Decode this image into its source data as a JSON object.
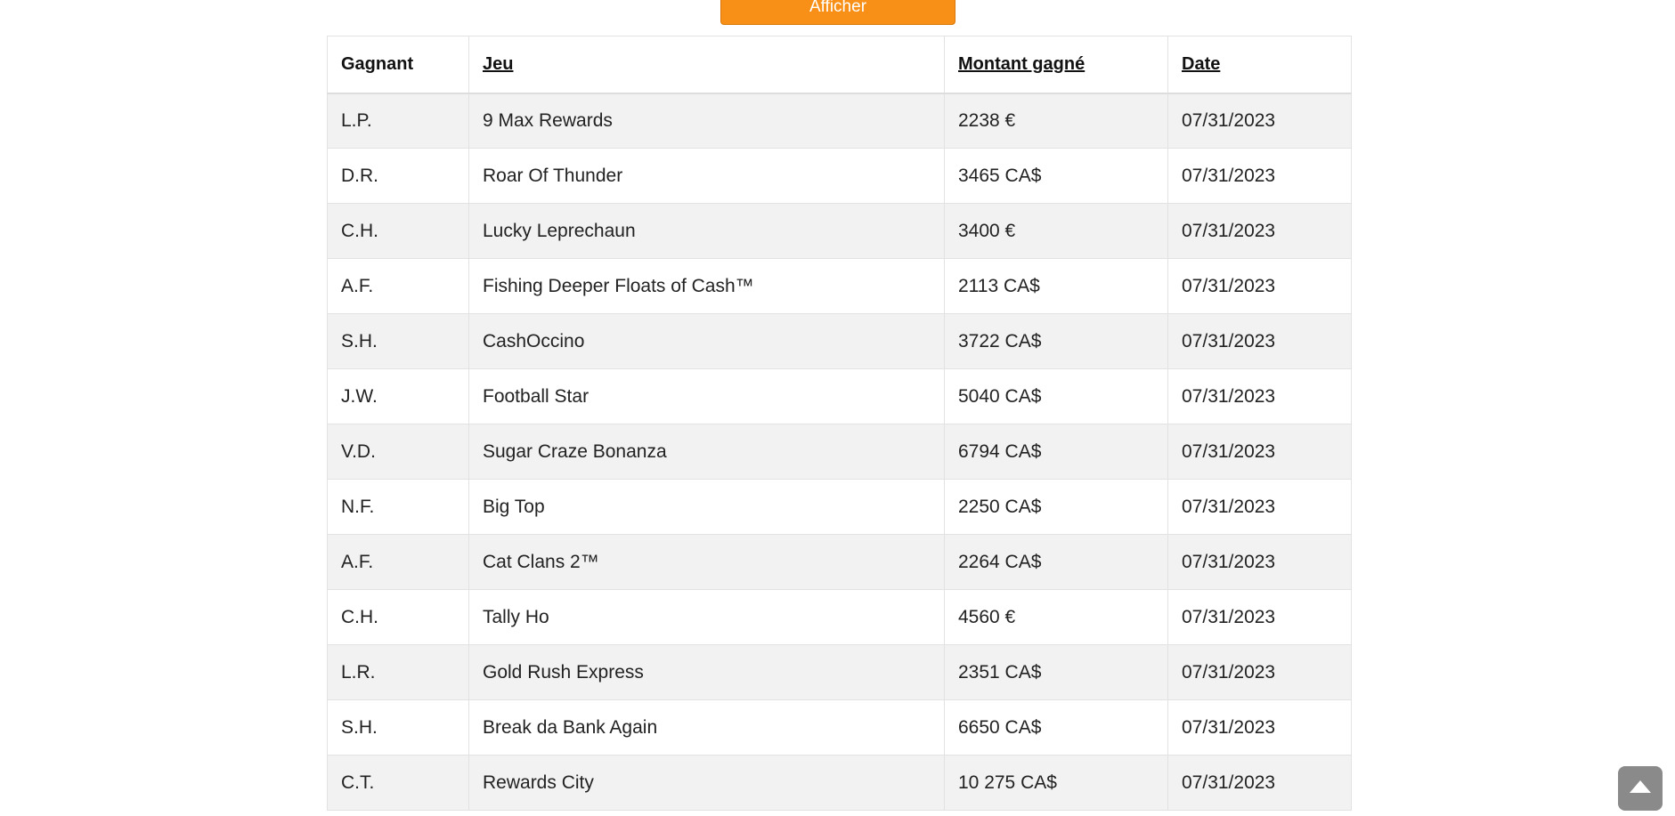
{
  "show_button": {
    "label": "Afficher"
  },
  "table": {
    "headers": {
      "winner": "Gagnant",
      "game": "Jeu",
      "amount": "Montant gagné",
      "date": "Date"
    },
    "rows": [
      {
        "winner": "L.P.",
        "game": "9 Max Rewards",
        "amount": "2238 €",
        "date": "07/31/2023"
      },
      {
        "winner": "D.R.",
        "game": "Roar Of Thunder",
        "amount": "3465 CA$",
        "date": "07/31/2023"
      },
      {
        "winner": "C.H.",
        "game": "Lucky Leprechaun",
        "amount": "3400 €",
        "date": "07/31/2023"
      },
      {
        "winner": "A.F.",
        "game": "Fishing Deeper Floats of Cash™",
        "amount": "2113 CA$",
        "date": "07/31/2023"
      },
      {
        "winner": "S.H.",
        "game": "CashOccino",
        "amount": "3722 CA$",
        "date": "07/31/2023"
      },
      {
        "winner": "J.W.",
        "game": "Football Star",
        "amount": "5040 CA$",
        "date": "07/31/2023"
      },
      {
        "winner": "V.D.",
        "game": "Sugar Craze Bonanza",
        "amount": "6794 CA$",
        "date": "07/31/2023"
      },
      {
        "winner": "N.F.",
        "game": "Big Top",
        "amount": "2250 CA$",
        "date": "07/31/2023"
      },
      {
        "winner": "A.F.",
        "game": "Cat Clans 2™",
        "amount": "2264 CA$",
        "date": "07/31/2023"
      },
      {
        "winner": "C.H.",
        "game": "Tally Ho",
        "amount": "4560 €",
        "date": "07/31/2023"
      },
      {
        "winner": "L.R.",
        "game": "Gold Rush Express",
        "amount": "2351 CA$",
        "date": "07/31/2023"
      },
      {
        "winner": "S.H.",
        "game": "Break da Bank Again",
        "amount": "6650 CA$",
        "date": "07/31/2023"
      },
      {
        "winner": "C.T.",
        "game": "Rewards City",
        "amount": "10 275 CA$",
        "date": "07/31/2023"
      }
    ]
  },
  "scroll_top": {
    "icon": "arrow-up-icon"
  },
  "colors": {
    "accent": "#f89017",
    "row_stripe": "#f2f2f2",
    "border": "#e2e2e2",
    "scroll_button": "#8a8a8a"
  }
}
